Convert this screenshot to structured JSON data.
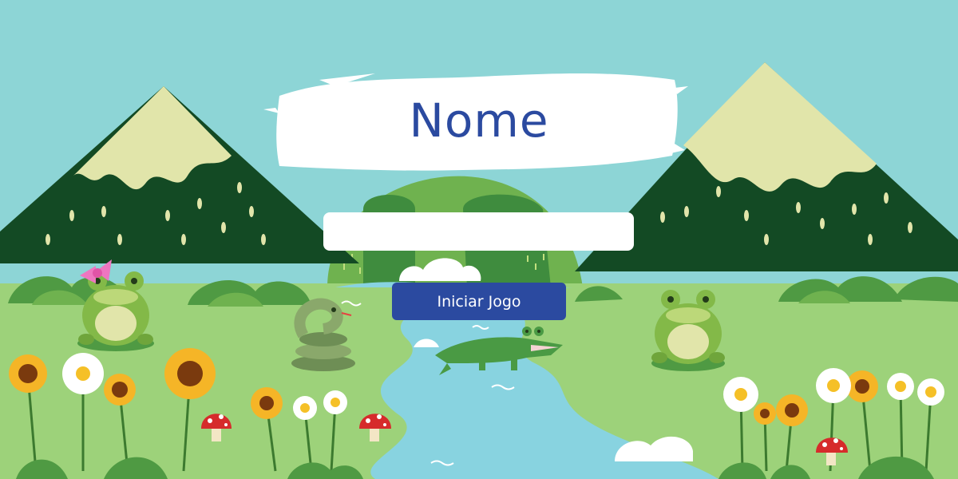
{
  "title": "Nome",
  "name_input": {
    "value": "",
    "placeholder": ""
  },
  "start_button": {
    "label": "Iniciar Jogo"
  },
  "colors": {
    "sky": "#8dd5d6",
    "accent": "#2b4aa0",
    "mountain": "#134a24",
    "snow": "#e1e5aa",
    "grass": "#9dd27a",
    "river": "#88d3e0"
  },
  "icons": [
    "mountain-icon",
    "frog-with-bow-icon",
    "frog-icon",
    "snake-icon",
    "crocodile-icon",
    "sunflower-icon",
    "daisy-icon",
    "mushroom-icon",
    "cloud-icon"
  ]
}
